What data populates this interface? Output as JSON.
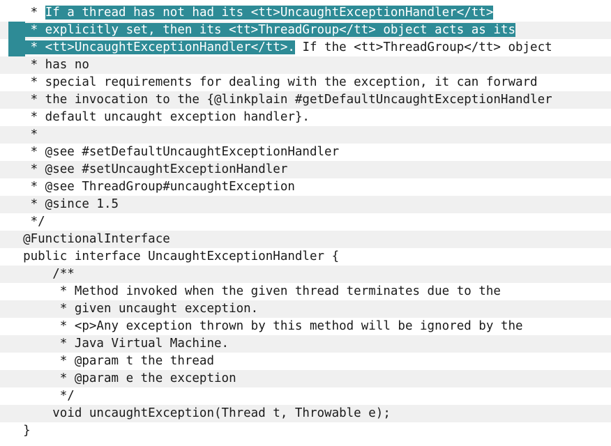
{
  "editor": {
    "selection_color": "#2e8b96",
    "stripe_color": "#f0f0f0",
    "lines": [
      {
        "segments": [
          {
            "text": "   * ",
            "sel": false
          },
          {
            "text": "If a thread has not had its <tt>UncaughtExceptionHandler</tt>",
            "sel": true
          }
        ]
      },
      {
        "segments": [
          {
            "text": "   * explicitly set, then its <tt>ThreadGroup</tt> object acts as its",
            "sel": true
          }
        ]
      },
      {
        "segments": [
          {
            "text": "   * <tt>UncaughtExceptionHandler</tt>.",
            "sel": true
          },
          {
            "text": " If the <tt>ThreadGroup</tt> object",
            "sel": false
          }
        ]
      },
      {
        "segments": [
          {
            "text": "   * has no",
            "sel": false
          }
        ]
      },
      {
        "segments": [
          {
            "text": "   * special requirements for dealing with the exception, it can forward",
            "sel": false
          }
        ]
      },
      {
        "segments": [
          {
            "text": "   * the invocation to the {@linkplain #getDefaultUncaughtExceptionHandler",
            "sel": false
          }
        ]
      },
      {
        "segments": [
          {
            "text": "   * default uncaught exception handler}.",
            "sel": false
          }
        ]
      },
      {
        "segments": [
          {
            "text": "   *",
            "sel": false
          }
        ]
      },
      {
        "segments": [
          {
            "text": "   * @see #setDefaultUncaughtExceptionHandler",
            "sel": false
          }
        ]
      },
      {
        "segments": [
          {
            "text": "   * @see #setUncaughtExceptionHandler",
            "sel": false
          }
        ]
      },
      {
        "segments": [
          {
            "text": "   * @see ThreadGroup#uncaughtException",
            "sel": false
          }
        ]
      },
      {
        "segments": [
          {
            "text": "   * @since 1.5",
            "sel": false
          }
        ]
      },
      {
        "segments": [
          {
            "text": "   */",
            "sel": false
          }
        ]
      },
      {
        "segments": [
          {
            "text": "  @FunctionalInterface",
            "sel": false
          }
        ]
      },
      {
        "segments": [
          {
            "text": "  public interface UncaughtExceptionHandler {",
            "sel": false
          }
        ]
      },
      {
        "segments": [
          {
            "text": "      /**",
            "sel": false
          }
        ]
      },
      {
        "segments": [
          {
            "text": "       * Method invoked when the given thread terminates due to the",
            "sel": false
          }
        ]
      },
      {
        "segments": [
          {
            "text": "       * given uncaught exception.",
            "sel": false
          }
        ]
      },
      {
        "segments": [
          {
            "text": "       * <p>Any exception thrown by this method will be ignored by the",
            "sel": false
          }
        ]
      },
      {
        "segments": [
          {
            "text": "       * Java Virtual Machine.",
            "sel": false
          }
        ]
      },
      {
        "segments": [
          {
            "text": "       * @param t the thread",
            "sel": false
          }
        ]
      },
      {
        "segments": [
          {
            "text": "       * @param e the exception",
            "sel": false
          }
        ]
      },
      {
        "segments": [
          {
            "text": "       */",
            "sel": false
          }
        ]
      },
      {
        "segments": [
          {
            "text": "      void uncaughtException(Thread t, Throwable e);",
            "sel": false
          }
        ]
      },
      {
        "segments": [
          {
            "text": "  }",
            "sel": false
          }
        ]
      }
    ]
  }
}
